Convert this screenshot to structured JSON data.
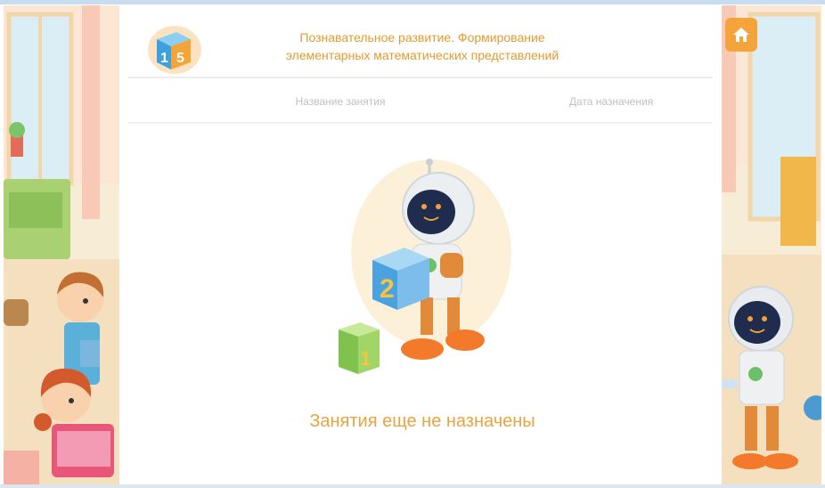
{
  "header": {
    "title_line1": "Познавательное развитие. Формирование",
    "title_line2": "элементарных математических представлений"
  },
  "table": {
    "columns": [
      "Название занятия",
      "Дата назначения"
    ]
  },
  "empty_state": {
    "message": "Занятия еще не назначены"
  },
  "illustration": {
    "cube_big_number": "2",
    "cube_small_number": "1"
  },
  "subject_icon": {
    "digits": [
      "1",
      "5"
    ]
  },
  "colors": {
    "accent": "#e39b2f",
    "home_button": "#f4a43a",
    "muted_text": "#c0c0c0"
  }
}
